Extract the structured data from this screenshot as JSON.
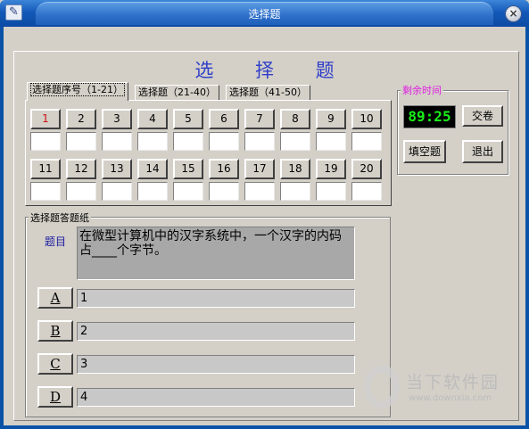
{
  "window": {
    "title": "选择题",
    "close_glyph": "×"
  },
  "page": {
    "heading": "选 择 题"
  },
  "tabs": [
    {
      "label": "选择题序号（1-21）"
    },
    {
      "label": "选择题（21-40）"
    },
    {
      "label": "选择题（41-50）"
    }
  ],
  "questions": {
    "row1": [
      "1",
      "2",
      "3",
      "4",
      "5",
      "6",
      "7",
      "8",
      "9",
      "10"
    ],
    "row2": [
      "11",
      "12",
      "13",
      "14",
      "15",
      "16",
      "17",
      "18",
      "19",
      "20"
    ],
    "current": "1"
  },
  "timer_group": {
    "label": "剩余时间",
    "time": "89:25",
    "submit_label": "交卷",
    "fill_blank_label": "填空题",
    "exit_label": "退出"
  },
  "answer_sheet": {
    "label": "选择题答题纸",
    "question_label": "题目",
    "question_text": "在微型计算机中的汉字系统中，一个汉字的内码占____个字节。",
    "options": [
      {
        "key": "A",
        "value": "1"
      },
      {
        "key": "B",
        "value": "2"
      },
      {
        "key": "C",
        "value": "3"
      },
      {
        "key": "D",
        "value": "4"
      }
    ]
  },
  "watermark": {
    "text": "当下软件园",
    "url": "www.downxia.com"
  },
  "colors": {
    "title_bar": "#1459b8",
    "heading": "#2f3fc9",
    "timer_digits": "#19f019",
    "group_label_pink": "#e020e0",
    "current_question": "#d01010"
  }
}
